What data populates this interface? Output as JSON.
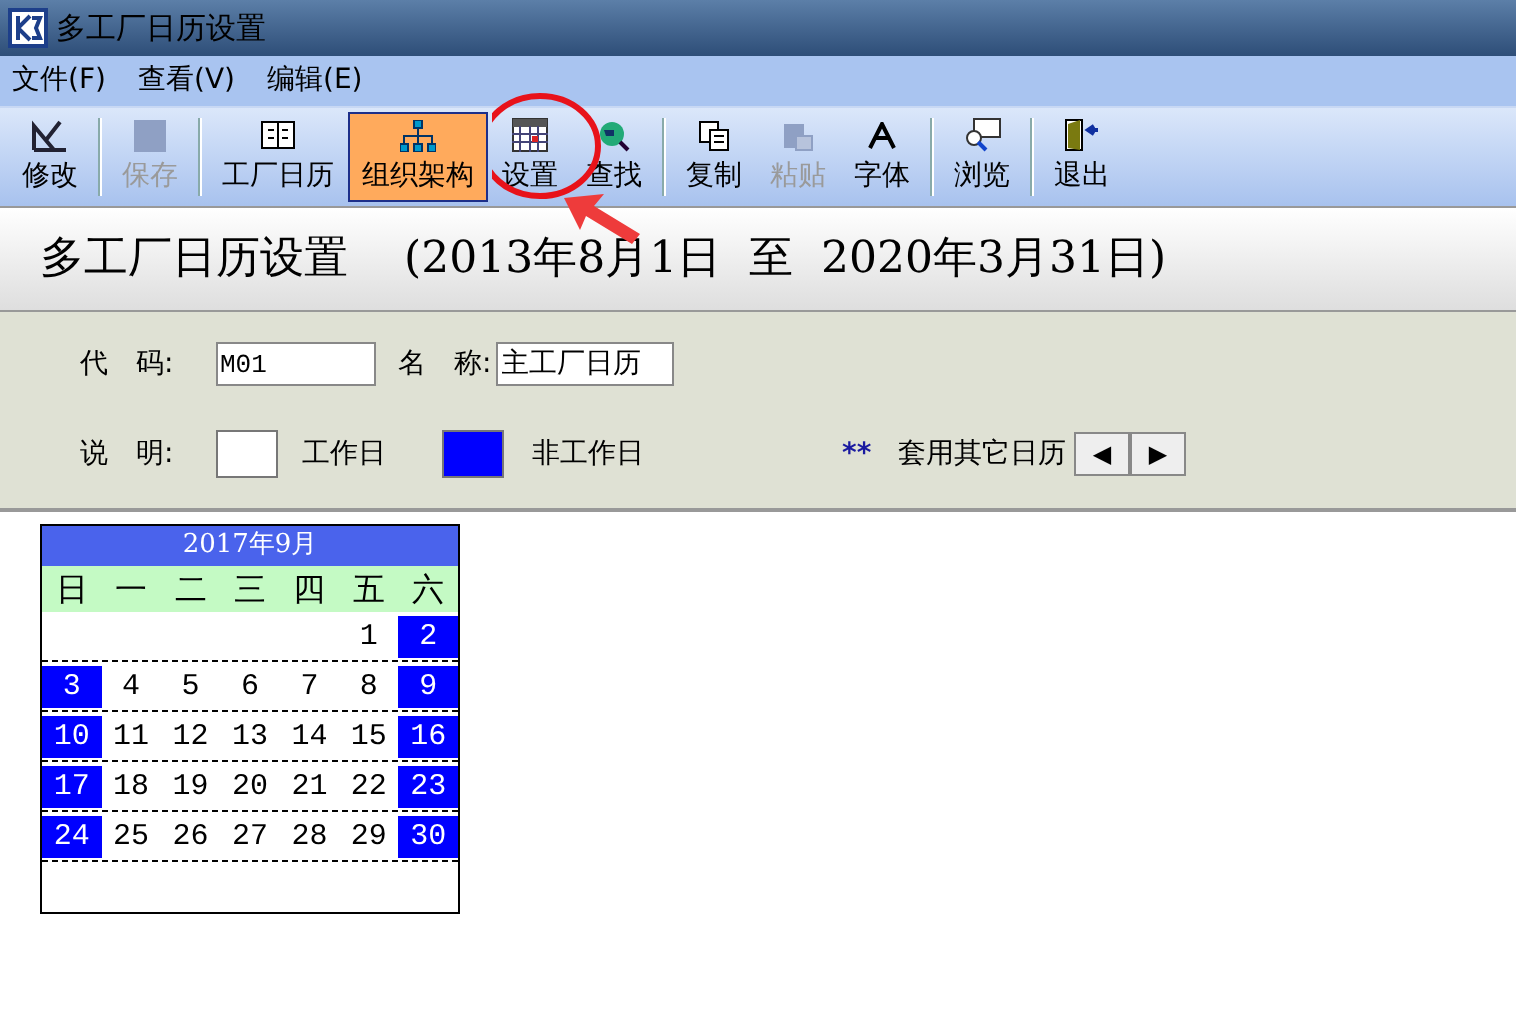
{
  "window": {
    "title": "多工厂日历设置"
  },
  "menu": [
    "文件(F)",
    "查看(V)",
    "编辑(E)"
  ],
  "toolbar": {
    "groups": [
      [
        {
          "label": "修改",
          "disabled": false,
          "selected": false
        }
      ],
      [
        {
          "label": "保存",
          "disabled": true,
          "selected": false
        }
      ],
      [
        {
          "label": "工厂日历",
          "disabled": false,
          "selected": false
        },
        {
          "label": "组织架构",
          "disabled": false,
          "selected": true
        },
        {
          "label": "设置",
          "disabled": false,
          "selected": false
        },
        {
          "label": "查找",
          "disabled": false,
          "selected": false
        }
      ],
      [
        {
          "label": "复制",
          "disabled": false,
          "selected": false
        },
        {
          "label": "粘贴",
          "disabled": true,
          "selected": false
        },
        {
          "label": "字体",
          "disabled": false,
          "selected": false
        }
      ],
      [
        {
          "label": "浏览",
          "disabled": false,
          "selected": false
        }
      ],
      [
        {
          "label": "退出",
          "disabled": false,
          "selected": false
        }
      ]
    ]
  },
  "header": {
    "title": "多工厂日历设置",
    "range": "(2013年8月1日  至  2020年3月31日)"
  },
  "form": {
    "code_label": "代　码:",
    "code_value": "M01",
    "name_label": "名　称:",
    "name_value": "主工厂日历",
    "legend_label": "说　明:",
    "workday_label": "工作日",
    "offday_label": "非工作日",
    "mark": "**",
    "mark_label": "套用其它日历",
    "prev": "◀",
    "next": "▶"
  },
  "calendar": {
    "title": "2017年9月",
    "weekdays": [
      "日",
      "一",
      "二",
      "三",
      "四",
      "五",
      "六"
    ],
    "weeks": [
      [
        {
          "day": "1",
          "off": false
        },
        {
          "day": "2",
          "off": true
        }
      ],
      [
        {
          "day": "3",
          "off": true
        },
        {
          "day": "4",
          "off": false
        },
        {
          "day": "5",
          "off": false
        },
        {
          "day": "6",
          "off": false
        },
        {
          "day": "7",
          "off": false
        },
        {
          "day": "8",
          "off": false
        },
        {
          "day": "9",
          "off": true
        }
      ],
      [
        {
          "day": "10",
          "off": true
        },
        {
          "day": "11",
          "off": false
        },
        {
          "day": "12",
          "off": false
        },
        {
          "day": "13",
          "off": false
        },
        {
          "day": "14",
          "off": false
        },
        {
          "day": "15",
          "off": false
        },
        {
          "day": "16",
          "off": true
        }
      ],
      [
        {
          "day": "17",
          "off": true
        },
        {
          "day": "18",
          "off": false
        },
        {
          "day": "19",
          "off": false
        },
        {
          "day": "20",
          "off": false
        },
        {
          "day": "21",
          "off": false
        },
        {
          "day": "22",
          "off": false
        },
        {
          "day": "23",
          "off": true
        }
      ],
      [
        {
          "day": "24",
          "off": true
        },
        {
          "day": "25",
          "off": false
        },
        {
          "day": "26",
          "off": false
        },
        {
          "day": "27",
          "off": false
        },
        {
          "day": "28",
          "off": false
        },
        {
          "day": "29",
          "off": false
        },
        {
          "day": "30",
          "off": true
        }
      ]
    ]
  }
}
